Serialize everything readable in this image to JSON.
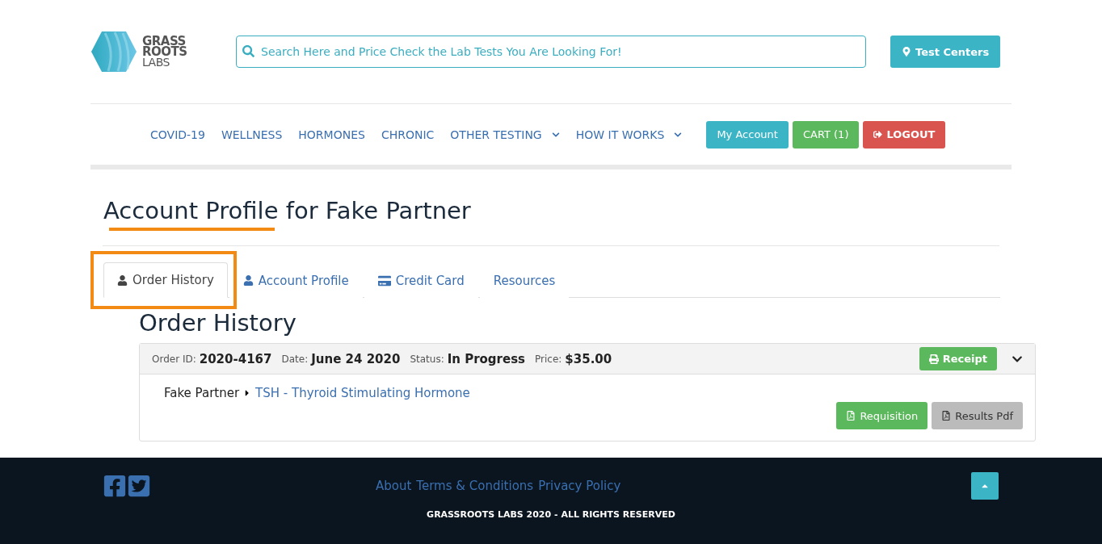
{
  "header": {
    "logo": [
      "GRASS",
      "ROOTS",
      "LABS"
    ],
    "search": {
      "placeholder": "Search Here and Price Check the Lab Tests You Are Looking For!"
    },
    "test_centers": "Test Centers"
  },
  "nav": {
    "items": [
      {
        "label": "COVID-19",
        "dropdown": false
      },
      {
        "label": "WELLNESS",
        "dropdown": false
      },
      {
        "label": "HORMONES",
        "dropdown": false
      },
      {
        "label": "CHRONIC",
        "dropdown": false
      },
      {
        "label": "OTHER TESTING",
        "dropdown": true
      },
      {
        "label": "HOW IT WORKS",
        "dropdown": true
      }
    ],
    "buttons": [
      {
        "kind": "account",
        "label": "My Account"
      },
      {
        "kind": "cart",
        "label": "CART (1)"
      },
      {
        "kind": "logout",
        "label": "LOGOUT"
      }
    ]
  },
  "page_title": "Account Profile for Fake Partner",
  "tabs": [
    {
      "label": "Order History",
      "kind": "user",
      "selected": true
    },
    {
      "label": "Account Profile",
      "kind": "user",
      "selected": false
    },
    {
      "label": "Credit Card",
      "kind": "card",
      "selected": false
    },
    {
      "label": "Resources",
      "kind": "plain",
      "selected": false
    }
  ],
  "section_title": "Order History",
  "orders": [
    {
      "fields": [
        {
          "label": "Order ID:",
          "value": "2020-4167"
        },
        {
          "label": "Date:",
          "value": "June 24 2020"
        },
        {
          "label": "Status:",
          "value": "In Progress"
        },
        {
          "label": "Price:",
          "value": "$35.00"
        }
      ],
      "receipt": "Receipt",
      "expanded": true,
      "patient": "Fake Partner",
      "test": "TSH - Thyroid Stimulating Hormone",
      "requisition": "Requisition",
      "results": "Results Pdf",
      "results_disabled": true
    }
  ],
  "footer": {
    "links": [
      "About",
      "Terms & Conditions",
      "Privacy Policy"
    ],
    "copyright": "GRASSROOTS LABS 2020 - ALL RIGHTS RESERVED"
  }
}
